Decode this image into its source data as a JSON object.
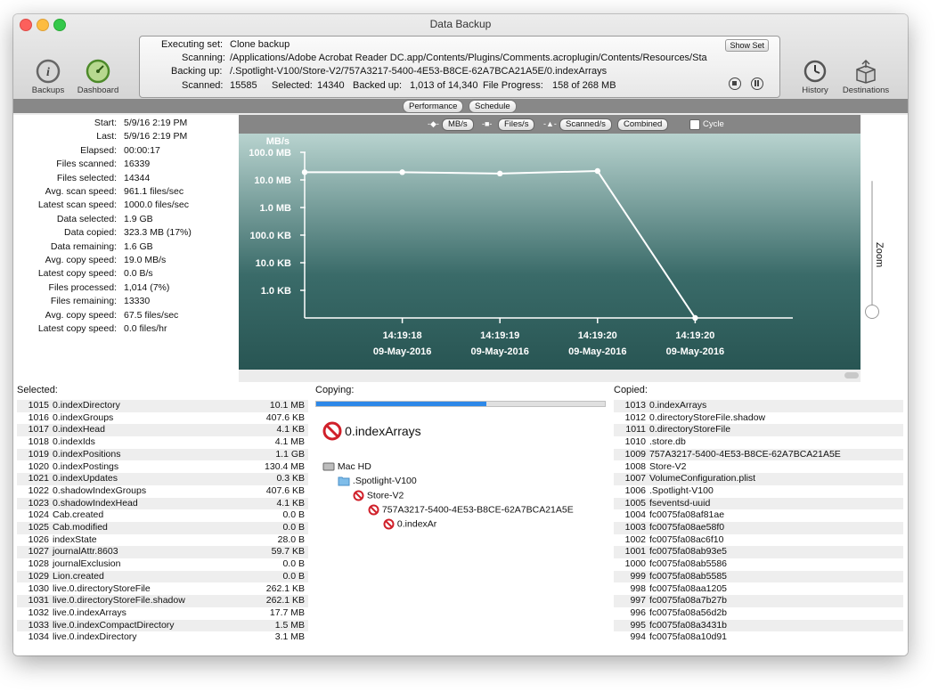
{
  "window": {
    "title": "Data Backup"
  },
  "toolbar": {
    "backups_label": "Backups",
    "dashboard_label": "Dashboard",
    "history_label": "History",
    "destinations_label": "Destinations"
  },
  "status": {
    "executing_label": "Executing set:",
    "executing_value": "Clone backup",
    "scanning_label": "Scanning:",
    "scanning_value": "/Applications/Adobe Acrobat Reader DC.app/Contents/Plugins/Comments.acroplugin/Contents/Resources/Sta",
    "backing_label": "Backing up:",
    "backing_value": "/.Spotlight-V100/Store-V2/757A3217-5400-4E53-B8CE-62A7BCA21A5E/0.indexArrays",
    "scanned_label": "Scanned:",
    "scanned_value": "15585",
    "selected_label": "Selected:",
    "selected_value": "14340",
    "backed_label": "Backed up:",
    "backed_value": "1,013 of 14,340",
    "progress_label": "File Progress:",
    "progress_value": "158 of 268 MB",
    "show_set_label": "Show Set"
  },
  "tabs": {
    "performance": "Performance",
    "schedule": "Schedule"
  },
  "stats": [
    {
      "label": "Start:",
      "value": "5/9/16 2:19 PM"
    },
    {
      "label": "Last:",
      "value": "5/9/16 2:19 PM"
    },
    {
      "label": "Elapsed:",
      "value": "00:00:17"
    },
    {
      "label": "Files scanned:",
      "value": "16339"
    },
    {
      "label": "Files selected:",
      "value": "14344"
    },
    {
      "label": "Avg. scan speed:",
      "value": "961.1 files/sec"
    },
    {
      "label": "Latest scan speed:",
      "value": "1000.0 files/sec"
    },
    {
      "label": "Data selected:",
      "value": "1.9 GB"
    },
    {
      "label": "Data copied:",
      "value": "323.3 MB (17%)"
    },
    {
      "label": "Data remaining:",
      "value": "1.6 GB"
    },
    {
      "label": "Avg. copy speed:",
      "value": "19.0 MB/s"
    },
    {
      "label": "Latest copy speed:",
      "value": "0.0 B/s"
    },
    {
      "label": "Files processed:",
      "value": "1,014 (7%)"
    },
    {
      "label": "Files remaining:",
      "value": "13330"
    },
    {
      "label": "Avg. copy speed:",
      "value": "67.5 files/sec"
    },
    {
      "label": "Latest copy speed:",
      "value": "0.0 files/hr"
    }
  ],
  "chart_legend": {
    "mbs": "MB/s",
    "files": "Files/s",
    "scanned": "Scanned/s",
    "combined": "Combined",
    "cycle": "Cycle"
  },
  "zoom_label": "Zoom",
  "chart_data": {
    "type": "line",
    "ylabel": "MB/s",
    "y_ticks": [
      "100.0 MB",
      "10.0 MB",
      "1.0 MB",
      "100.0 KB",
      "10.0 KB",
      "1.0 KB"
    ],
    "y_tick_mb": [
      100,
      10,
      1,
      0.1,
      0.01,
      0.001
    ],
    "x_labels": [
      {
        "time": "14:19:18",
        "date": "09-May-2016"
      },
      {
        "time": "14:19:19",
        "date": "09-May-2016"
      },
      {
        "time": "14:19:20",
        "date": "09-May-2016"
      },
      {
        "time": "14:19:20",
        "date": "09-May-2016"
      }
    ],
    "series": [
      {
        "x": [
          0.0,
          1.0,
          2.0,
          3.0,
          4.0
        ],
        "values_mb": [
          19.0,
          19.0,
          17.0,
          21.0,
          0.0
        ]
      }
    ],
    "y_scale": "log",
    "grid": false
  },
  "selected": {
    "title": "Selected:",
    "rows": [
      {
        "n": "1015",
        "name": "0.indexDirectory",
        "size": "10.1 MB"
      },
      {
        "n": "1016",
        "name": "0.indexGroups",
        "size": "407.6 KB"
      },
      {
        "n": "1017",
        "name": "0.indexHead",
        "size": "4.1 KB"
      },
      {
        "n": "1018",
        "name": "0.indexIds",
        "size": "4.1 MB"
      },
      {
        "n": "1019",
        "name": "0.indexPositions",
        "size": "1.1 GB"
      },
      {
        "n": "1020",
        "name": "0.indexPostings",
        "size": "130.4 MB"
      },
      {
        "n": "1021",
        "name": "0.indexUpdates",
        "size": "0.3 KB"
      },
      {
        "n": "1022",
        "name": "0.shadowIndexGroups",
        "size": "407.6 KB"
      },
      {
        "n": "1023",
        "name": "0.shadowIndexHead",
        "size": "4.1 KB"
      },
      {
        "n": "1024",
        "name": "Cab.created",
        "size": "0.0 B"
      },
      {
        "n": "1025",
        "name": "Cab.modified",
        "size": "0.0 B"
      },
      {
        "n": "1026",
        "name": "indexState",
        "size": "28.0 B"
      },
      {
        "n": "1027",
        "name": "journalAttr.8603",
        "size": "59.7 KB"
      },
      {
        "n": "1028",
        "name": "journalExclusion",
        "size": "0.0 B"
      },
      {
        "n": "1029",
        "name": "Lion.created",
        "size": "0.0 B"
      },
      {
        "n": "1030",
        "name": "live.0.directoryStoreFile",
        "size": "262.1 KB"
      },
      {
        "n": "1031",
        "name": "live.0.directoryStoreFile.shadow",
        "size": "262.1 KB"
      },
      {
        "n": "1032",
        "name": "live.0.indexArrays",
        "size": "17.7 MB"
      },
      {
        "n": "1033",
        "name": "live.0.indexCompactDirectory",
        "size": "1.5 MB"
      },
      {
        "n": "1034",
        "name": "live.0.indexDirectory",
        "size": "3.1 MB"
      }
    ]
  },
  "copying": {
    "title": "Copying:",
    "progress": 0.59,
    "current_file": "0.indexArrays",
    "tree": [
      "Mac HD",
      ".Spotlight-V100",
      "Store-V2",
      "757A3217-5400-4E53-B8CE-62A7BCA21A5E",
      "0.indexAr"
    ]
  },
  "copied": {
    "title": "Copied:",
    "rows": [
      {
        "n": "1013",
        "name": "0.indexArrays"
      },
      {
        "n": "1012",
        "name": "0.directoryStoreFile.shadow"
      },
      {
        "n": "1011",
        "name": "0.directoryStoreFile"
      },
      {
        "n": "1010",
        "name": ".store.db"
      },
      {
        "n": "1009",
        "name": "757A3217-5400-4E53-B8CE-62A7BCA21A5E"
      },
      {
        "n": "1008",
        "name": "Store-V2"
      },
      {
        "n": "1007",
        "name": "VolumeConfiguration.plist"
      },
      {
        "n": "1006",
        "name": ".Spotlight-V100"
      },
      {
        "n": "1005",
        "name": "fseventsd-uuid"
      },
      {
        "n": "1004",
        "name": "fc0075fa08af81ae"
      },
      {
        "n": "1003",
        "name": "fc0075fa08ae58f0"
      },
      {
        "n": "1002",
        "name": "fc0075fa08ac6f10"
      },
      {
        "n": "1001",
        "name": "fc0075fa08ab93e5"
      },
      {
        "n": "1000",
        "name": "fc0075fa08ab5586"
      },
      {
        "n": "999",
        "name": "fc0075fa08ab5585"
      },
      {
        "n": "998",
        "name": "fc0075fa08aa1205"
      },
      {
        "n": "997",
        "name": "fc0075fa08a7b27b"
      },
      {
        "n": "996",
        "name": "fc0075fa08a56d2b"
      },
      {
        "n": "995",
        "name": "fc0075fa08a3431b"
      },
      {
        "n": "994",
        "name": "fc0075fa08a10d91"
      }
    ]
  }
}
